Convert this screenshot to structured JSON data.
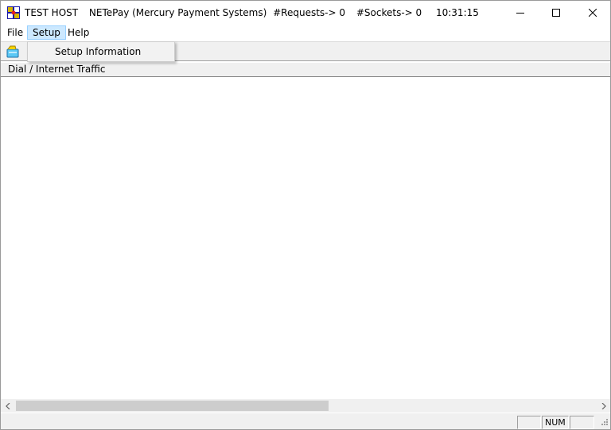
{
  "window": {
    "app_name": "TEST HOST",
    "subtitle": "NETePay (Mercury Payment Systems)",
    "requests": "#Requests-> 0",
    "sockets": "#Sockets-> 0",
    "time": "10:31:15"
  },
  "controls": {
    "minimize": "minimize-icon",
    "maximize": "maximize-icon",
    "close": "close-icon"
  },
  "menu": {
    "file": "File",
    "setup": "Setup",
    "help": "Help"
  },
  "dropdown": {
    "items": [
      {
        "label": "Setup Information"
      }
    ]
  },
  "toolbar": {
    "icon": "open-icon"
  },
  "panel": {
    "header": "Dial / Internet Traffic"
  },
  "status": {
    "pane1": "",
    "pane2": "NUM",
    "pane3": ""
  },
  "colors": {
    "menu_highlight": "#cce8ff",
    "menu_border": "#99d1ff",
    "chrome": "#f0f0f0"
  }
}
